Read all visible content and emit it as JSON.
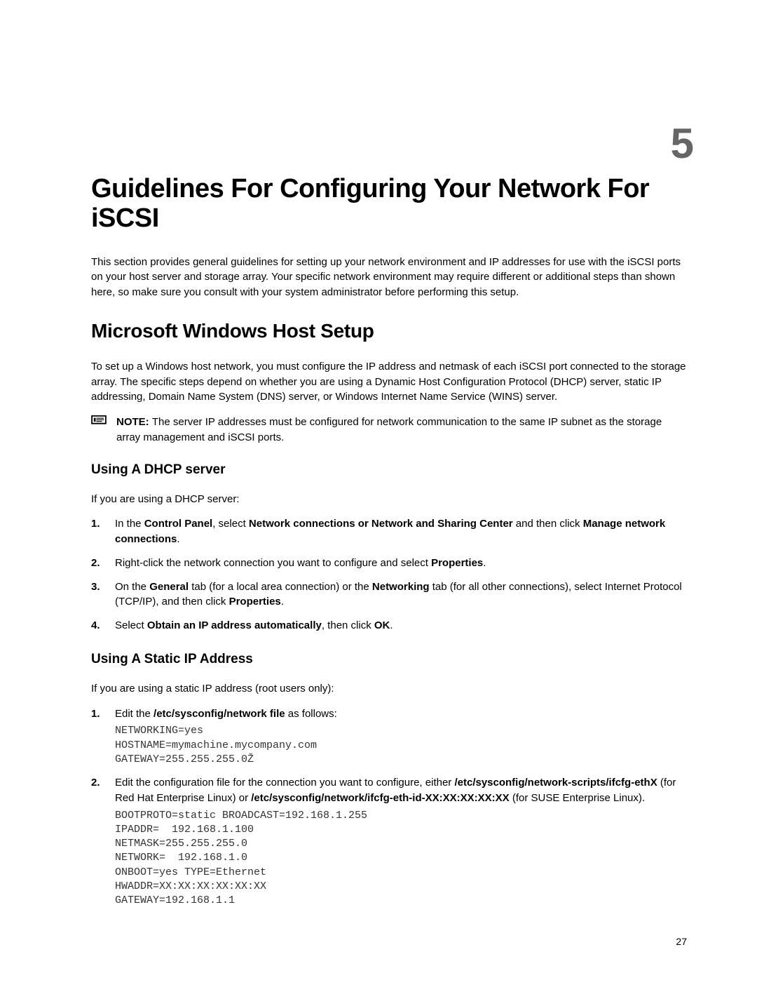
{
  "chapter_number": "5",
  "title": "Guidelines For Configuring Your Network For iSCSI",
  "intro": "This section provides general guidelines for setting up your network environment and IP addresses for use with the iSCSI ports on your host server and storage array. Your specific network environment may require different or additional steps than shown here, so make sure you consult with your system administrator before performing this setup.",
  "section1": {
    "heading": "Microsoft Windows Host Setup",
    "para": "To set up a Windows host network, you must configure the IP address and netmask of each iSCSI port connected to the storage array. The specific steps depend on whether you are using a Dynamic Host Configuration Protocol (DHCP) server, static IP addressing, Domain Name System (DNS) server, or Windows Internet Name Service (WINS) server.",
    "note_label": "NOTE: ",
    "note_text": "The server IP addresses must be configured for network communication to the same IP subnet as the storage array management and iSCSI ports."
  },
  "sub1": {
    "heading": "Using A DHCP server",
    "lead": "If you are using a DHCP server:",
    "steps": [
      {
        "num": "1.",
        "pre": "In the ",
        "b1": "Control Panel",
        "mid1": ", select ",
        "b2": "Network connections or Network and Sharing Center",
        "mid2": " and then click ",
        "b3": "Manage network connections",
        "post": "."
      },
      {
        "num": "2.",
        "pre": "Right-click the network connection you want to configure and select ",
        "b1": "Properties",
        "post": "."
      },
      {
        "num": "3.",
        "pre": "On the ",
        "b1": "General",
        "mid1": " tab (for a local area connection) or the ",
        "b2": "Networking",
        "mid2": " tab (for all other connections), select Internet Protocol (TCP/IP), and then click ",
        "b3": "Properties",
        "post": "."
      },
      {
        "num": "4.",
        "pre": "Select ",
        "b1": "Obtain an IP address automatically",
        "mid1": ", then click ",
        "b2": "OK",
        "post": "."
      }
    ]
  },
  "sub2": {
    "heading": "Using A Static IP Address",
    "lead": "If you are using a static IP address (root users only):",
    "step1": {
      "num": "1.",
      "pre": "Edit the ",
      "b1": "/etc/sysconfig/network file",
      "post": " as follows:",
      "code": "NETWORKING=yes\nHOSTNAME=mymachine.mycompany.com\nGATEWAY=255.255.255.0Ž"
    },
    "step2": {
      "num": "2.",
      "pre": "Edit the configuration file for the connection you want to configure, either ",
      "b1": "/etc/sysconfig/network-scripts/ifcfg-ethX",
      "mid1": " (for Red Hat Enterprise Linux) or ",
      "b2": "/etc/sysconfig/network/ifcfg-eth-id-XX:XX:XX:XX:XX",
      "post": " (for SUSE Enterprise Linux).",
      "code": "BOOTPROTO=static BROADCAST=192.168.1.255\nIPADDR=  192.168.1.100\nNETMASK=255.255.255.0\nNETWORK=  192.168.1.0\nONBOOT=yes TYPE=Ethernet\nHWADDR=XX:XX:XX:XX:XX:XX\nGATEWAY=192.168.1.1"
    }
  },
  "page_number": "27"
}
